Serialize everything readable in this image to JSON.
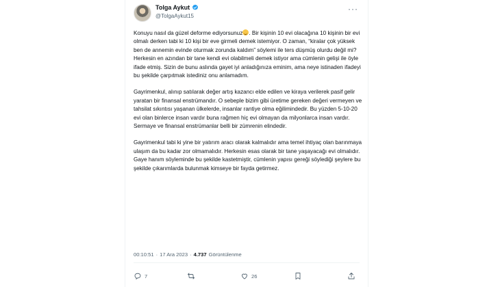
{
  "tweet": {
    "author": {
      "display_name": "Tolga Aykut",
      "handle": "@TolgaAykut15"
    },
    "paragraphs": [
      [
        "Konuyu nasıl da güzel deforme ediyorsunuz",
        ". Bir kişinin 10 evi olacağına 10 kişinin bir evi olmalı derken tabi ki 10 kişi bir eve girmeli demek istemiyor. O zaman, “kiralar çok yüksek ben de annemin evinde oturmak zorunda kaldım” söylemi ile ters düşmüş olurdu değil mi? Herkesin en azından bir tane kendi evi olabilmeli demek istiyor ama cümlenin gelişi ile öyle ifade etmiş. Sizin de bunu aslında gayet iyi anladığınıza eminim, ama neye istinaden ifadeyi bu şekilde çarpıtmak istediniz onu anlamadım."
      ],
      [
        "Gayrimenkul, alınıp satılarak değer artış kazancı elde edilen ve kiraya verilerek pasif gelir yaratan bir finansal enstrümandır. O sebeple bizim gibi üretime gereken değeri vermeyen ve tahsilat sıkıntısı yaşanan ülkelerde, insanlar rantiye olma eğilimindedir. Bu yüzden 5-10-20 evi olan binlerce insan vardır buna rağmen hiç evi olmayan da milyonlarca insan vardır. Sermaye ve finansal enstrümanlar belli bir zümrenin elindedir."
      ],
      [
        "Gayrimenkul tabi ki yine bir yatırım aracı olarak kalmalıdır ama temel ihtiyaç olan barınmaya ulaşım da bu kadar zor olmamalıdır.  Herkesin esas olarak bir tane yaşayacağı evi olmalıdır. Gaye hanım söyleminde bu şekilde kastetmiştir, cümlenin yapısı gereği söylediği şeylere bu şekilde çıkarımlarda bulunmak kimseye bir fayda getirmez."
      ]
    ],
    "meta": {
      "time": "00:10:51",
      "date": "17 Ara 2023",
      "views": "4.737",
      "views_label": "Görüntülenme"
    },
    "actions": {
      "replies": "7",
      "retweets": "",
      "likes": "26"
    }
  },
  "icons": {
    "verified": "verified-badge-icon",
    "more": "more-options-icon",
    "reply": "reply-icon",
    "retweet": "retweet-icon",
    "like": "heart-icon",
    "bookmark": "bookmark-icon",
    "share": "share-icon"
  },
  "colors": {
    "text": "#0f1419",
    "secondary": "#536471",
    "verified": "#1d9bf0",
    "border": "#eff3f4"
  }
}
